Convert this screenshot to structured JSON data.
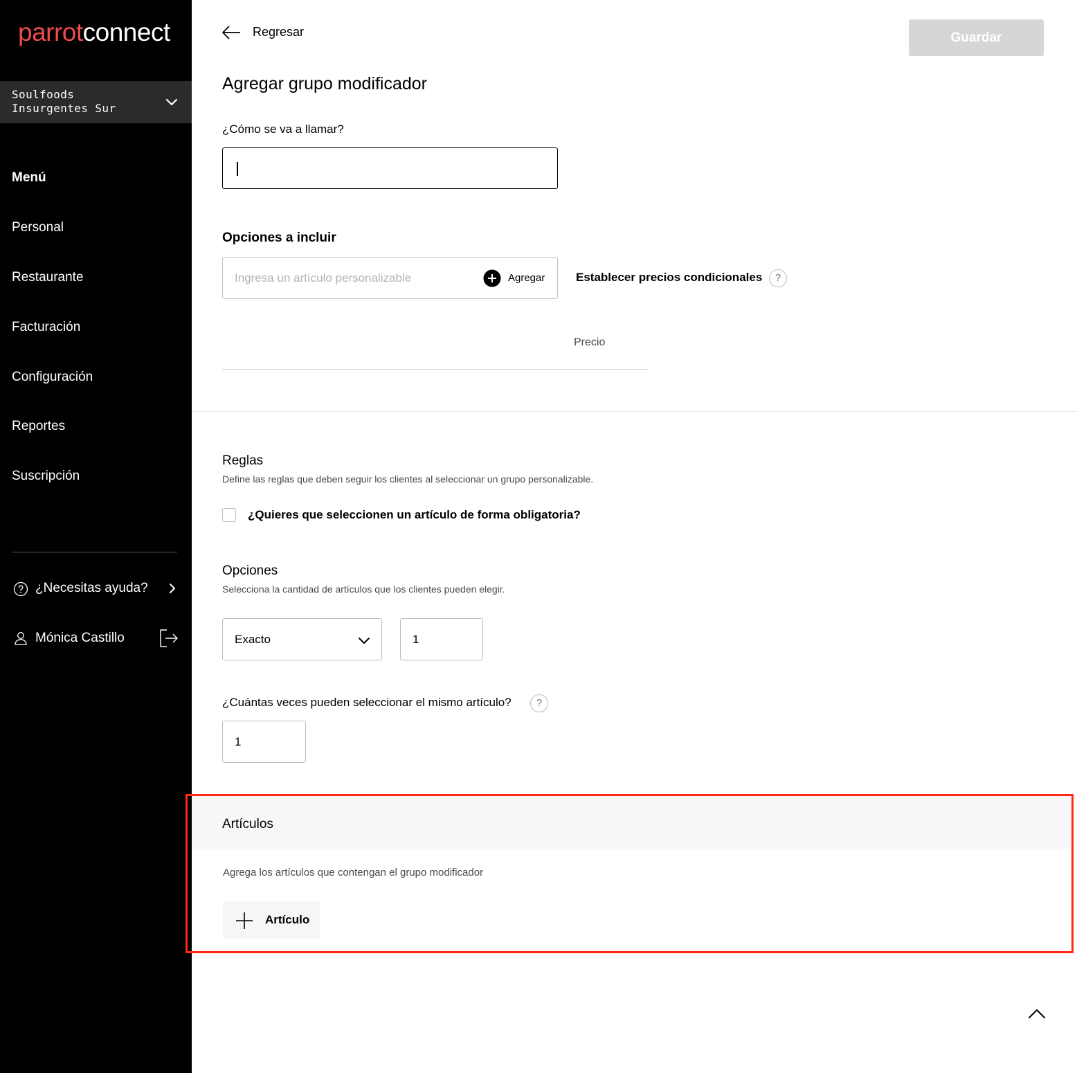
{
  "sidebar": {
    "logo_part1": "parrot",
    "logo_part2": "connect",
    "branch_line1": "Soulfoods",
    "branch_line2": "Insurgentes Sur",
    "nav": [
      "Menú",
      "Personal",
      "Restaurante",
      "Facturación",
      "Configuración",
      "Reportes",
      "Suscripción"
    ],
    "help_label": "¿Necesitas ayuda?",
    "user_name": "Mónica Castillo"
  },
  "header": {
    "back_label": "Regresar",
    "save_label": "Guardar"
  },
  "form": {
    "title": "Agregar grupo modificador",
    "name_label": "¿Cómo se va a llamar?",
    "name_value": "",
    "options_title": "Opciones a incluir",
    "option_placeholder": "Ingresa un artículo personalizable",
    "add_label": "Agregar",
    "conditional_label": "Establecer precios condicionales",
    "help_glyph": "?",
    "price_header": "Precio"
  },
  "rules": {
    "title": "Reglas",
    "description": "Define las reglas que deben seguir los clientes al seleccionar un grupo personalizable.",
    "required_label": "¿Quieres que seleccionen un artículo de forma obligatoria?"
  },
  "options": {
    "title": "Opciones",
    "description": "Selecciona la cantidad de artículos que los clientes pueden elegir.",
    "mode_value": "Exacto",
    "quantity_value": "1",
    "same_item_label": "¿Cuántas veces pueden seleccionar el mismo artículo?",
    "same_item_value": "1"
  },
  "articles": {
    "title": "Artículos",
    "description": "Agrega los artículos que contengan el grupo modificador",
    "add_button_label": "Artículo"
  },
  "colors": {
    "brand": "#f04b4c",
    "highlight": "#ff2a12",
    "sidebar_bg": "#000000"
  }
}
